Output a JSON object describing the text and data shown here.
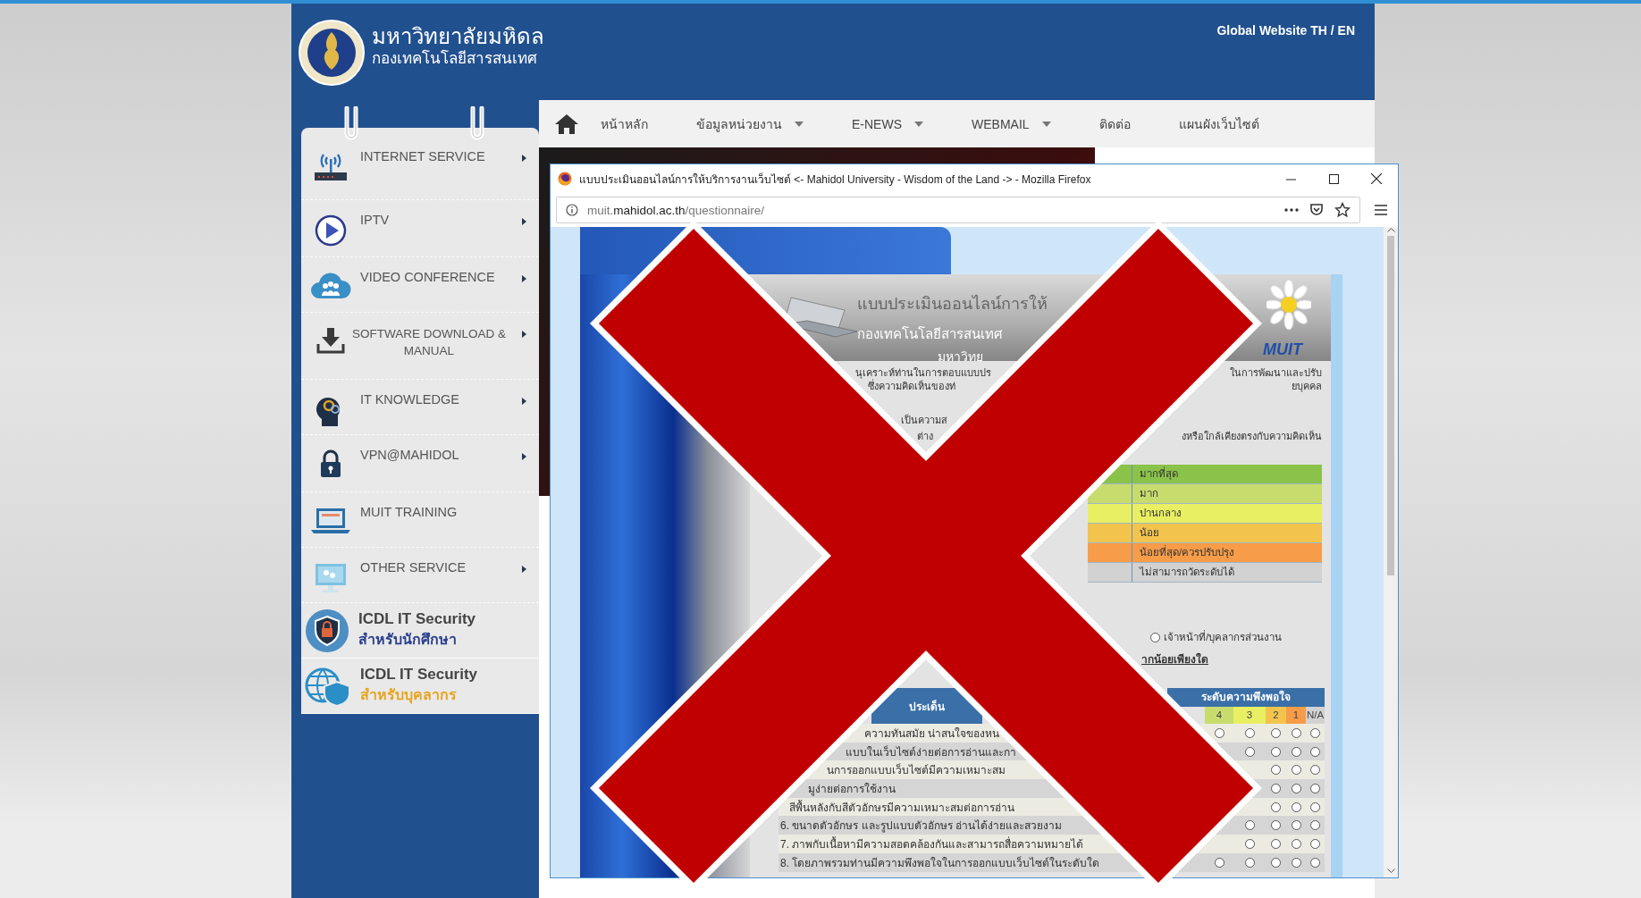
{
  "header": {
    "title": "มหาวิทยาลัยมหิดล",
    "subtitle": "กองเทคโนโลยีสารสนเทศ",
    "global_link": "Global Website TH / EN"
  },
  "nav": {
    "items": [
      {
        "label": "หน้าหลัก",
        "dropdown": false
      },
      {
        "label": "ข้อมูลหน่วยงาน",
        "dropdown": true
      },
      {
        "label": "E-NEWS",
        "dropdown": true
      },
      {
        "label": "WEBMAIL",
        "dropdown": true
      },
      {
        "label": "ติดต่อ",
        "dropdown": false
      },
      {
        "label": "แผนผังเว็บไซต์",
        "dropdown": false
      }
    ]
  },
  "sidebar": {
    "items": [
      {
        "label": "INTERNET SERVICE",
        "kind": "single",
        "submenu": true
      },
      {
        "label": "IPTV",
        "kind": "single",
        "submenu": true
      },
      {
        "label": "VIDEO CONFERENCE",
        "kind": "single",
        "submenu": true
      },
      {
        "label": "SOFTWARE DOWNLOAD & MANUAL",
        "kind": "wrapped",
        "submenu": true
      },
      {
        "label": "IT KNOWLEDGE",
        "kind": "single",
        "submenu": true
      },
      {
        "label": "VPN@MAHIDOL",
        "kind": "single",
        "submenu": true
      },
      {
        "label": "MUIT TRAINING",
        "kind": "single",
        "submenu": false
      },
      {
        "label": "OTHER SERVICE",
        "kind": "single",
        "submenu": true
      }
    ],
    "promos": [
      {
        "title": "ICDL IT Security",
        "subtitle": "สำหรับนักศึกษา",
        "color": "#2b3f8f"
      },
      {
        "title": "ICDL IT Security",
        "subtitle": "สำหรับบุคลากร",
        "color": "#e6a520"
      }
    ]
  },
  "browser": {
    "title": "แบบประเมินออนไลน์การให้บริการงานเว็บไซต์ <- Mahidol University - Wisdom of the Land -> - Mozilla Firefox",
    "url": "muit.**mahidol.ac.th**/questionnaire/"
  },
  "questionnaire": {
    "heading": "แบบประเมินออนไลน์การให้",
    "unit": "กองเทคโนโลยีสารสนเทศ",
    "university": "มหาวิทย",
    "logo": "MUIT",
    "intro": [
      {
        "left": "นุเคราะห์ท่านในการตอบแบบปร",
        "right": "ในการพัฒนาและปรับ"
      },
      {
        "left": "ซึ่งความคิดเห็นของท่",
        "right": "ยบุคคล"
      }
    ],
    "instructions": [
      {
        "left": "เป็นความส"
      },
      {
        "left": "ต่าง",
        "right": "งหรือใกล้เคียงตรงกับความคิดเห็น"
      }
    ],
    "legend": [
      {
        "label": "มากที่สุด",
        "color": "#8bc34a"
      },
      {
        "label": "มาก",
        "color": "#c8dc6e"
      },
      {
        "label": "ปานกลาง",
        "color": "#e9ef62"
      },
      {
        "label": "น้อย",
        "color": "#f2c44e"
      },
      {
        "label": "น้อยที่สุด/ควรปรับปรุง",
        "color": "#f79c48"
      },
      {
        "label": "ไม่สามารถวัดระดับได้",
        "color": "#d2d2d2"
      }
    ],
    "respondent_option": {
      "label": "เจ้าหน้าที่/บุคลากรส่วนงาน",
      "checked": false
    },
    "question_fragment": "ากน้อยเพียงใด",
    "table": {
      "topic_header": "ประเด็น",
      "satisfaction_header": "ระดับความพึงพอใจ",
      "levels": [
        {
          "label": "4",
          "color": "#c8dc6e"
        },
        {
          "label": "3",
          "color": "#e9ef62"
        },
        {
          "label": "2",
          "color": "#f2c44e"
        },
        {
          "label": "1",
          "color": "#f79c48"
        },
        {
          "label": "N/A",
          "color": "#d2d2d2"
        }
      ],
      "rows": [
        {
          "text": "ความทันสมัย น่าสนใจของหน",
          "kind": "partial",
          "checked": [
            false,
            false,
            false,
            false,
            false
          ]
        },
        {
          "text": "แบบในเว็บไซต์ง่ายต่อการอ่านและกา",
          "kind": "partial",
          "checked": [
            false,
            false,
            false,
            false
          ]
        },
        {
          "text": "นการออกแบบเว็บไซต์มีความเหมาะสม",
          "kind": "partial",
          "checked": [
            false,
            false,
            false
          ]
        },
        {
          "text": "มูง่ายต่อการใช้งาน",
          "kind": "partial",
          "checked": [
            false,
            false,
            false
          ]
        },
        {
          "text": "สีพื้นหลังกับสีตัวอักษรมีความเหมาะสมต่อการอ่าน",
          "kind": "partial",
          "checked": [
            false,
            false,
            false
          ]
        },
        {
          "text": "6. ขนาดตัวอักษร และรูปแบบตัวอักษร อ่านได้ง่ายและสวยงาม",
          "kind": "full",
          "checked": [
            false,
            false,
            false,
            false
          ]
        },
        {
          "text": "7. ภาพกับเนื้อหามีความสอดคล้องกันและสามารถสื่อความหมายได้",
          "kind": "full",
          "checked": [
            false,
            false,
            false,
            false
          ]
        },
        {
          "text": "8. โดยภาพรวมท่านมีความพึงพอใจในการออกแบบเว็บไซต์ในระดับใด",
          "kind": "full",
          "checked": [
            false,
            false,
            false,
            false,
            false
          ]
        }
      ]
    }
  }
}
